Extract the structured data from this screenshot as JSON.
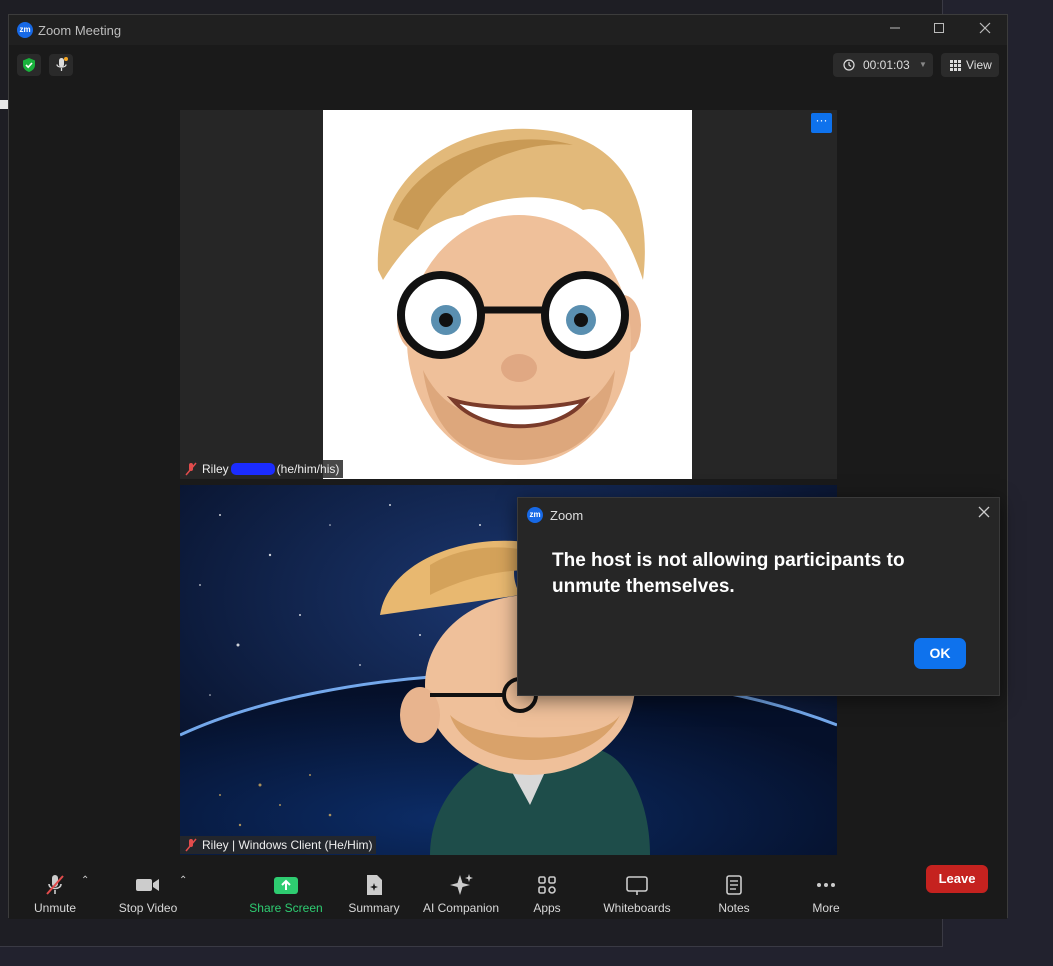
{
  "window": {
    "title": "Zoom Meeting",
    "app_badge": "zm"
  },
  "topbar": {
    "timer": "00:01:03",
    "view_label": "View"
  },
  "tiles": [
    {
      "name": "Riley",
      "pronouns": "(he/him/his)"
    },
    {
      "name": "Riley | Windows Client (He/Him)"
    }
  ],
  "toolbar": {
    "unmute": "Unmute",
    "stop_video": "Stop Video",
    "share_screen": "Share Screen",
    "summary": "Summary",
    "ai_companion": "AI Companion",
    "apps": "Apps",
    "whiteboards": "Whiteboards",
    "notes": "Notes",
    "more": "More",
    "leave": "Leave"
  },
  "dialog": {
    "title": "Zoom",
    "message": "The host is not allowing participants to unmute themselves.",
    "ok_label": "OK"
  },
  "colors": {
    "accent": "#0e72ed",
    "leave": "#c5221f",
    "share": "#2ecc71",
    "shield": "#19b33c"
  }
}
